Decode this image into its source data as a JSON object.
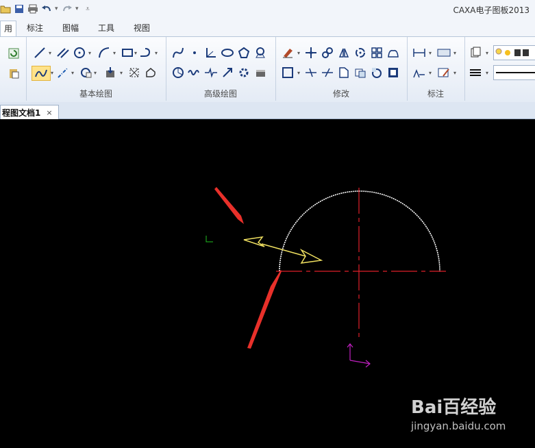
{
  "app": {
    "title": "CAXA电子图板2013"
  },
  "quick_access": {
    "icons": [
      "open-icon",
      "save-icon",
      "print-icon",
      "undo-icon",
      "redo-icon",
      "customize-icon"
    ]
  },
  "ribbon_tabs": [
    {
      "label": "用",
      "active": true
    },
    {
      "label": "标注"
    },
    {
      "label": "图幅"
    },
    {
      "label": "工具"
    },
    {
      "label": "视图"
    }
  ],
  "ribbon_groups": {
    "basic": "基本绘图",
    "advanced": "高级绘图",
    "modify": "修改",
    "annotate": "标注"
  },
  "document_tab": {
    "title": "程图文档1",
    "close": "×"
  },
  "canvas": {
    "shape": "semicircle",
    "colors": {
      "background": "#000000",
      "outline": "#ffffff",
      "centerline": "#e0202a",
      "arrows": "#f0e060",
      "annotation_arrow": "#e8302a",
      "ucs": "#c020c0",
      "cursor": "#20c020"
    }
  },
  "watermark": {
    "brand": "Bai百经验",
    "url": "jingyan.baidu.com"
  }
}
